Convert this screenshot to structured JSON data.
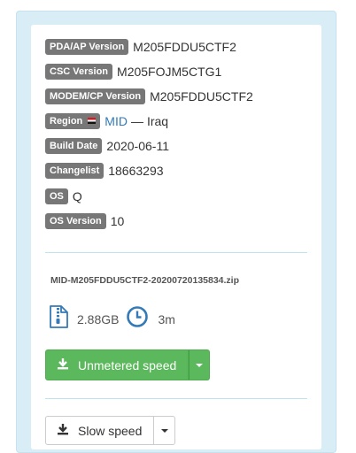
{
  "versions": {
    "pda": {
      "label": "PDA/AP Version",
      "value": "M205FDDU5CTF2"
    },
    "csc": {
      "label": "CSC Version",
      "value": "M205FOJM5CTG1"
    },
    "modem": {
      "label": "MODEM/CP Version",
      "value": "M205FDDU5CTF2"
    },
    "region": {
      "label": "Region",
      "code": "MID",
      "separator": "—",
      "country": "Iraq"
    },
    "build_date": {
      "label": "Build Date",
      "value": "2020-06-11"
    },
    "changelist": {
      "label": "Changelist",
      "value": "18663293"
    },
    "os": {
      "label": "OS",
      "value": "Q"
    },
    "os_version": {
      "label": "OS Version",
      "value": "10"
    }
  },
  "file": {
    "name": "MID-M205FDDU5CTF2-20200720135834.zip",
    "size": "2.88GB",
    "time": "3m",
    "file_icon": "zip-file-icon",
    "time_icon": "clock-icon"
  },
  "downloads": {
    "unmetered_label": "Unmetered speed",
    "slow_label": "Slow speed",
    "download_icon": "download-icon"
  },
  "colors": {
    "label_bg": "#777777",
    "link": "#337ab7",
    "success": "#5cb85c",
    "panel_bg": "#d9edf7"
  }
}
